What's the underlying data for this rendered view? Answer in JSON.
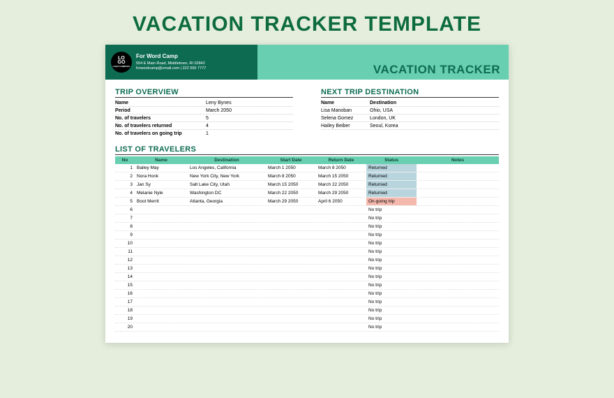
{
  "pageTitle": "VACATION TRACKER TEMPLATE",
  "header": {
    "logoTop": "LO",
    "logoBottom": "GO",
    "logoSub": "LOGO COMPANY",
    "companyName": "For Word Camp",
    "address": "554 E Main Road, Middletown, RI 02842",
    "contact": "forwordcamp@zmail.com | 222 555 7777",
    "trackerTitle": "VACATION TRACKER"
  },
  "overview": {
    "title": "TRIP OVERVIEW",
    "rows": [
      {
        "label": "Name",
        "value": "Leny Bynes"
      },
      {
        "label": "Period",
        "value": "March 2050"
      },
      {
        "label": "No. of travelers",
        "value": "5"
      },
      {
        "label": "No. of travelers returned",
        "value": "4"
      },
      {
        "label": "No. of travelers on going trip",
        "value": "1"
      }
    ]
  },
  "nextTrip": {
    "title": "NEXT TRIP DESTINATION",
    "cols": {
      "name": "Name",
      "dest": "Destination"
    },
    "rows": [
      {
        "name": "Lisa Manoban",
        "dest": "Ohio, USA"
      },
      {
        "name": "Selena Gomez",
        "dest": "London, UK"
      },
      {
        "name": "Hailey Beiber",
        "dest": "Seoul, Korea"
      }
    ]
  },
  "list": {
    "title": "LIST OF TRAVELERS",
    "cols": {
      "no": "No",
      "name": "Name",
      "dest": "Destination",
      "start": "Start Date",
      "ret": "Return Date",
      "status": "Status",
      "notes": "Notes"
    },
    "rows": [
      {
        "no": "1",
        "name": "Bailey May",
        "dest": "Los Angeles, California",
        "start": "March 1 2050",
        "ret": "March 8 2050",
        "status": "Returned",
        "statusClass": "returned",
        "notes": ""
      },
      {
        "no": "2",
        "name": "Nora Honk",
        "dest": "New York City, New York",
        "start": "March 8 2050",
        "ret": "March 15 2050",
        "status": "Returned",
        "statusClass": "returned",
        "notes": ""
      },
      {
        "no": "3",
        "name": "Jan Sy",
        "dest": "Salt Lake City, Utah",
        "start": "March 15 2050",
        "ret": "March 22 2050",
        "status": "Returned",
        "statusClass": "returned",
        "notes": ""
      },
      {
        "no": "4",
        "name": "Melanie Nyle",
        "dest": "Washington DC",
        "start": "March 22 2050",
        "ret": "March 29 2050",
        "status": "Returned",
        "statusClass": "returned",
        "notes": ""
      },
      {
        "no": "5",
        "name": "Boot Merrit",
        "dest": "Atlanta, Georgia",
        "start": "March 29 2050",
        "ret": "April 6 2050",
        "status": "On-going trip",
        "statusClass": "ongoing",
        "notes": ""
      },
      {
        "no": "6",
        "name": "",
        "dest": "",
        "start": "",
        "ret": "",
        "status": "No trip",
        "statusClass": "",
        "notes": ""
      },
      {
        "no": "7",
        "name": "",
        "dest": "",
        "start": "",
        "ret": "",
        "status": "No trip",
        "statusClass": "",
        "notes": ""
      },
      {
        "no": "8",
        "name": "",
        "dest": "",
        "start": "",
        "ret": "",
        "status": "No trip",
        "statusClass": "",
        "notes": ""
      },
      {
        "no": "9",
        "name": "",
        "dest": "",
        "start": "",
        "ret": "",
        "status": "No trip",
        "statusClass": "",
        "notes": ""
      },
      {
        "no": "10",
        "name": "",
        "dest": "",
        "start": "",
        "ret": "",
        "status": "No trip",
        "statusClass": "",
        "notes": ""
      },
      {
        "no": "11",
        "name": "",
        "dest": "",
        "start": "",
        "ret": "",
        "status": "No trip",
        "statusClass": "",
        "notes": ""
      },
      {
        "no": "12",
        "name": "",
        "dest": "",
        "start": "",
        "ret": "",
        "status": "No trip",
        "statusClass": "",
        "notes": ""
      },
      {
        "no": "13",
        "name": "",
        "dest": "",
        "start": "",
        "ret": "",
        "status": "No trip",
        "statusClass": "",
        "notes": ""
      },
      {
        "no": "14",
        "name": "",
        "dest": "",
        "start": "",
        "ret": "",
        "status": "No trip",
        "statusClass": "",
        "notes": ""
      },
      {
        "no": "15",
        "name": "",
        "dest": "",
        "start": "",
        "ret": "",
        "status": "No trip",
        "statusClass": "",
        "notes": ""
      },
      {
        "no": "16",
        "name": "",
        "dest": "",
        "start": "",
        "ret": "",
        "status": "No trip",
        "statusClass": "",
        "notes": ""
      },
      {
        "no": "17",
        "name": "",
        "dest": "",
        "start": "",
        "ret": "",
        "status": "No trip",
        "statusClass": "",
        "notes": ""
      },
      {
        "no": "18",
        "name": "",
        "dest": "",
        "start": "",
        "ret": "",
        "status": "No trip",
        "statusClass": "",
        "notes": ""
      },
      {
        "no": "19",
        "name": "",
        "dest": "",
        "start": "",
        "ret": "",
        "status": "No trip",
        "statusClass": "",
        "notes": ""
      },
      {
        "no": "20",
        "name": "",
        "dest": "",
        "start": "",
        "ret": "",
        "status": "No trip",
        "statusClass": "",
        "notes": ""
      }
    ]
  }
}
